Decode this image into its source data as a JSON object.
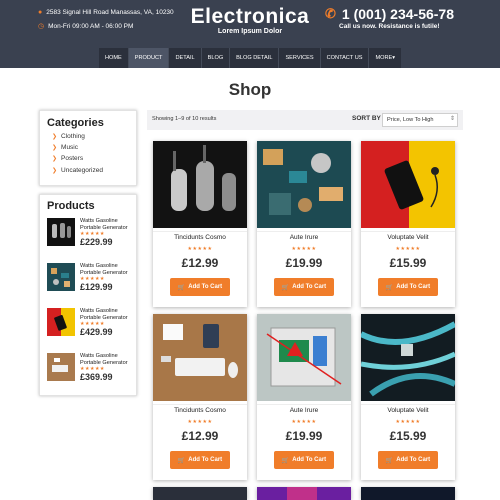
{
  "header": {
    "address": "2583 Signal Hill Road Manassas, VA, 10230",
    "hours": "Mon-Fri 09:00 AM - 06:00 PM",
    "brand": "Electronica",
    "tagline": "Lorem Ipsum Dolor",
    "phone": "1 (001) 234-56-78",
    "phone_note": "Call us now. Resistance is futile!",
    "icons": {
      "address": "map-pin-icon",
      "hours": "clock-icon",
      "phone": "phone-icon"
    }
  },
  "nav": [
    "HOME",
    "PRODUCT",
    "DETAIL",
    "BLOG",
    "BLOG DETAIL",
    "SERVICES",
    "CONTACT US",
    "MORE▾"
  ],
  "nav_active": "PRODUCT",
  "page_title": "Shop",
  "sidebar": {
    "categories_title": "Categories",
    "categories": [
      "Clothing",
      "Music",
      "Posters",
      "Uncategorized"
    ],
    "products_title": "Products",
    "products": [
      {
        "name": "Watts Gasoline Portable Generator",
        "stars": "★★★★★",
        "price": "£229.99"
      },
      {
        "name": "Watts Gasoline Portable Generator",
        "stars": "★★★★★",
        "price": "£129.99"
      },
      {
        "name": "Watts Gasoline Portable Generator",
        "stars": "★★★★★",
        "price": "£429.99"
      },
      {
        "name": "Watts Gasoline Portable Generator",
        "stars": "★★★★★",
        "price": "£369.99"
      }
    ]
  },
  "toolbar": {
    "showing": "Showing 1–9 of 10 results",
    "sort_label": "SORT BY",
    "sort_value": "Price, Low To High"
  },
  "products": [
    {
      "name": "Tincidunts Cosmo",
      "stars": "★★★★★",
      "price": "£12.99",
      "button": "Add To Cart"
    },
    {
      "name": "Aute Irure",
      "stars": "★★★★★",
      "price": "£19.99",
      "button": "Add To Cart"
    },
    {
      "name": "Voluptate Velit",
      "stars": "★★★★★",
      "price": "£15.99",
      "button": "Add To Cart"
    },
    {
      "name": "Tincidunts Cosmo",
      "stars": "★★★★★",
      "price": "£12.99",
      "button": "Add To Cart"
    },
    {
      "name": "Aute Irure",
      "stars": "★★★★★",
      "price": "£19.99",
      "button": "Add To Cart"
    },
    {
      "name": "Voluptate Velit",
      "stars": "★★★★★",
      "price": "£15.99",
      "button": "Add To Cart"
    }
  ],
  "colors": {
    "accent": "#f07d2a",
    "header_bg": "#3a4150",
    "nav_bg": "#2b303c"
  }
}
